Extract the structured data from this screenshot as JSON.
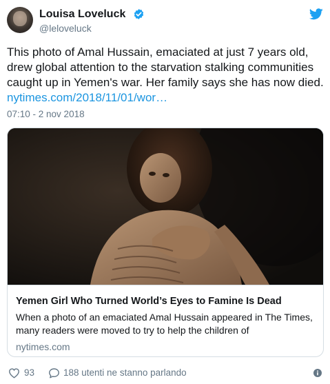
{
  "author": {
    "display_name": "Louisa Loveluck",
    "handle": "@leloveluck",
    "verified": true
  },
  "tweet": {
    "text": "This photo of Amal Hussain, emaciated at just 7 years old, drew global attention to the starvation stalking communities caught up in Yemen's war. Her family says she has now died.",
    "link": "nytimes.com/2018/11/01/wor…",
    "timestamp": "07:10 - 2 nov 2018"
  },
  "card": {
    "title": "Yemen Girl Who Turned World’s Eyes to Famine Is Dead",
    "description": "When a photo of an emaciated Amal Hussain appeared in The Times, many readers were moved to try to help the children of",
    "domain": "nytimes.com"
  },
  "footer": {
    "likes": "93",
    "conversation": "188 utenti ne stanno parlando"
  },
  "colors": {
    "accent": "#1da1f2",
    "link": "#1b95e0",
    "secondary_text": "#657786",
    "border": "#d5dde3"
  },
  "icons": [
    "verified-badge-icon",
    "twitter-bird-icon",
    "heart-icon",
    "speech-bubble-icon",
    "info-icon"
  ]
}
